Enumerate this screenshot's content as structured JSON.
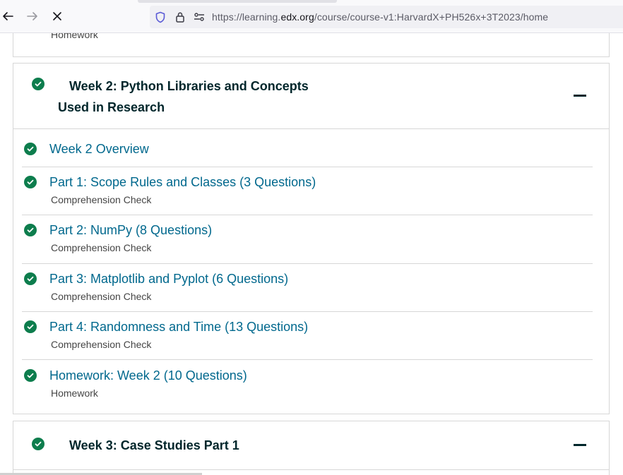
{
  "browser": {
    "url_prefix": "https://learning.",
    "url_domain": "edx.org",
    "url_path": "/course/course-v1:HarvardX+PH526x+3T2023/home",
    "icons": [
      "back-icon",
      "forward-icon",
      "stop-loading-icon",
      "shield-icon",
      "lock-icon",
      "permissions-icon"
    ]
  },
  "course": {
    "prev_section_tail": {
      "subtitle": "Homework"
    },
    "week2": {
      "title_line1": "Week 2: Python Libraries and Concepts",
      "title_line2": "Used in Research",
      "items": [
        {
          "title": "Week 2 Overview",
          "subtitle": ""
        },
        {
          "title": "Part 1: Scope Rules and Classes (3 Questions)",
          "subtitle": "Comprehension Check"
        },
        {
          "title": "Part 2: NumPy (8 Questions)",
          "subtitle": "Comprehension Check"
        },
        {
          "title": "Part 3: Matplotlib and Pyplot (6 Questions)",
          "subtitle": "Comprehension Check"
        },
        {
          "title": "Part 4: Randomness and Time (13 Questions)",
          "subtitle": "Comprehension Check"
        },
        {
          "title": "Homework: Week 2 (10 Questions)",
          "subtitle": "Homework"
        }
      ]
    },
    "week3": {
      "title": "Week 3: Case Studies Part 1"
    }
  },
  "colors": {
    "check_green": "#0d7d4d",
    "link_blue": "#00688d",
    "heading_dark": "#00262b"
  }
}
